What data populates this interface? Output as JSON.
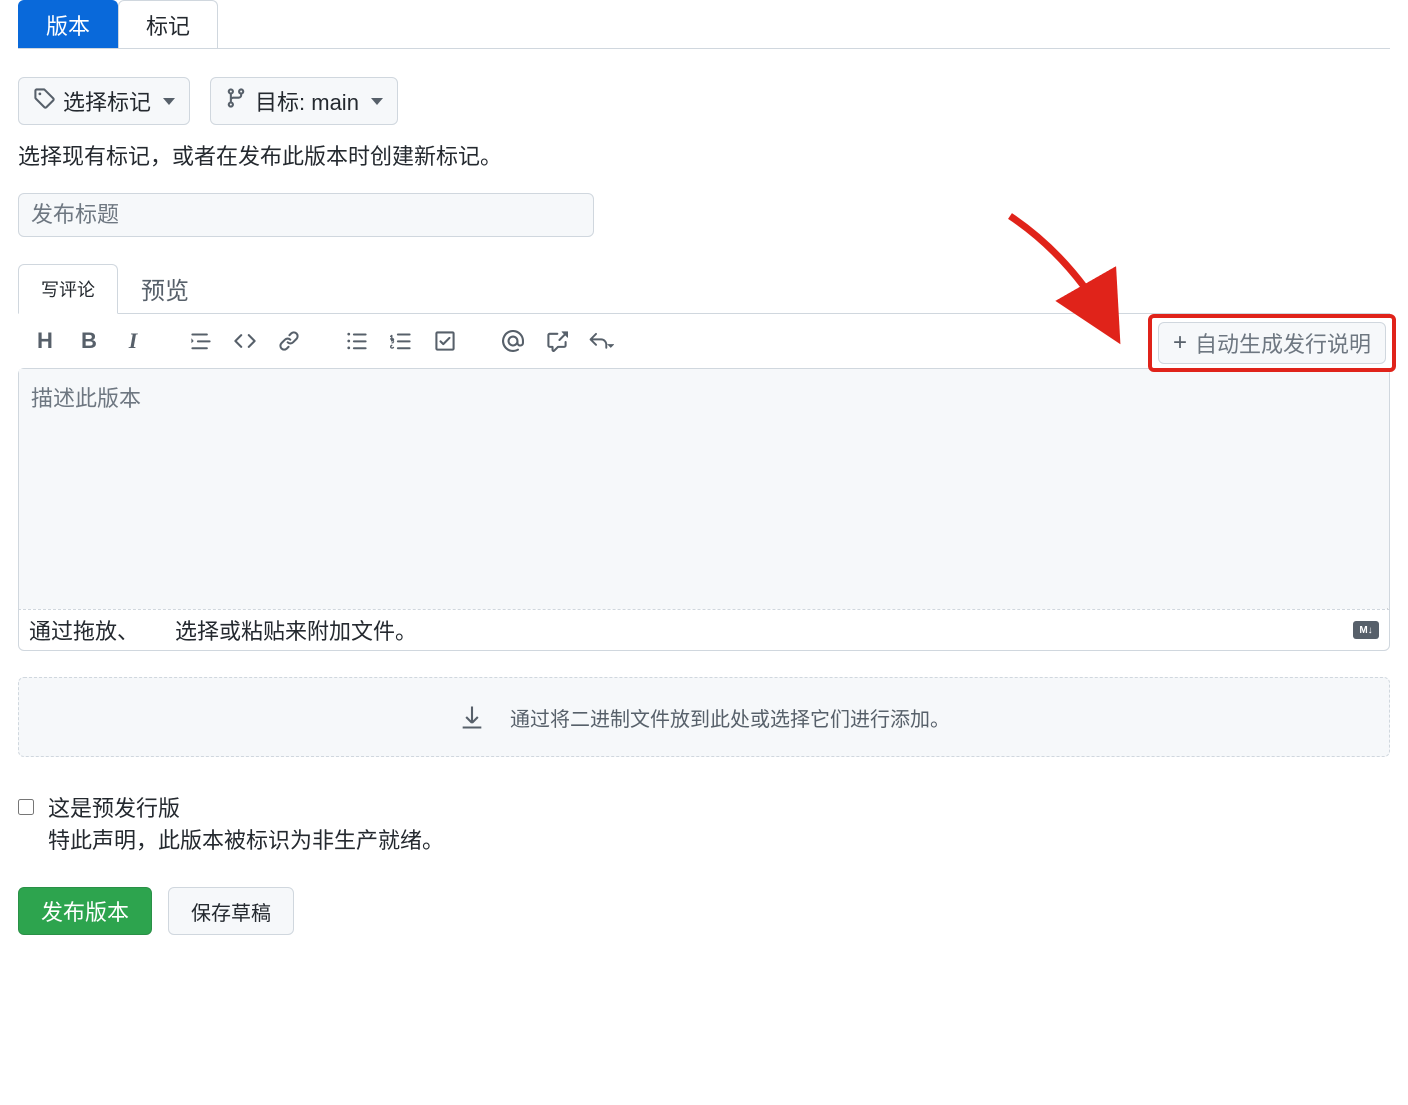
{
  "top_nav": {
    "tabs": [
      {
        "label": "版本",
        "active": true
      },
      {
        "label": "标记",
        "active": false
      }
    ]
  },
  "selectors": {
    "choose_tag_label": "选择标记",
    "target_label": "目标: main"
  },
  "helper_text": "选择现有标记，或者在发布此版本时创建新标记。",
  "title_placeholder": "发布标题",
  "editor_tabs": {
    "write": "写评论",
    "preview": "预览"
  },
  "toolbar": {
    "heading": "H",
    "bold": "B",
    "italic": "I"
  },
  "auto_generate_label": "自动生成发行说明",
  "description_placeholder": "描述此版本",
  "attach": {
    "drop": "通过拖放、",
    "select": "选择或粘贴来附加文件。"
  },
  "md_badge": "M↓",
  "binaries_zone": "通过将二进制文件放到此处或选择它们进行添加。",
  "prerelease": {
    "label": "这是预发行版",
    "sub": "特此声明，此版本被标识为非生产就绪。"
  },
  "actions": {
    "publish": "发布版本",
    "draft": "保存草稿"
  }
}
